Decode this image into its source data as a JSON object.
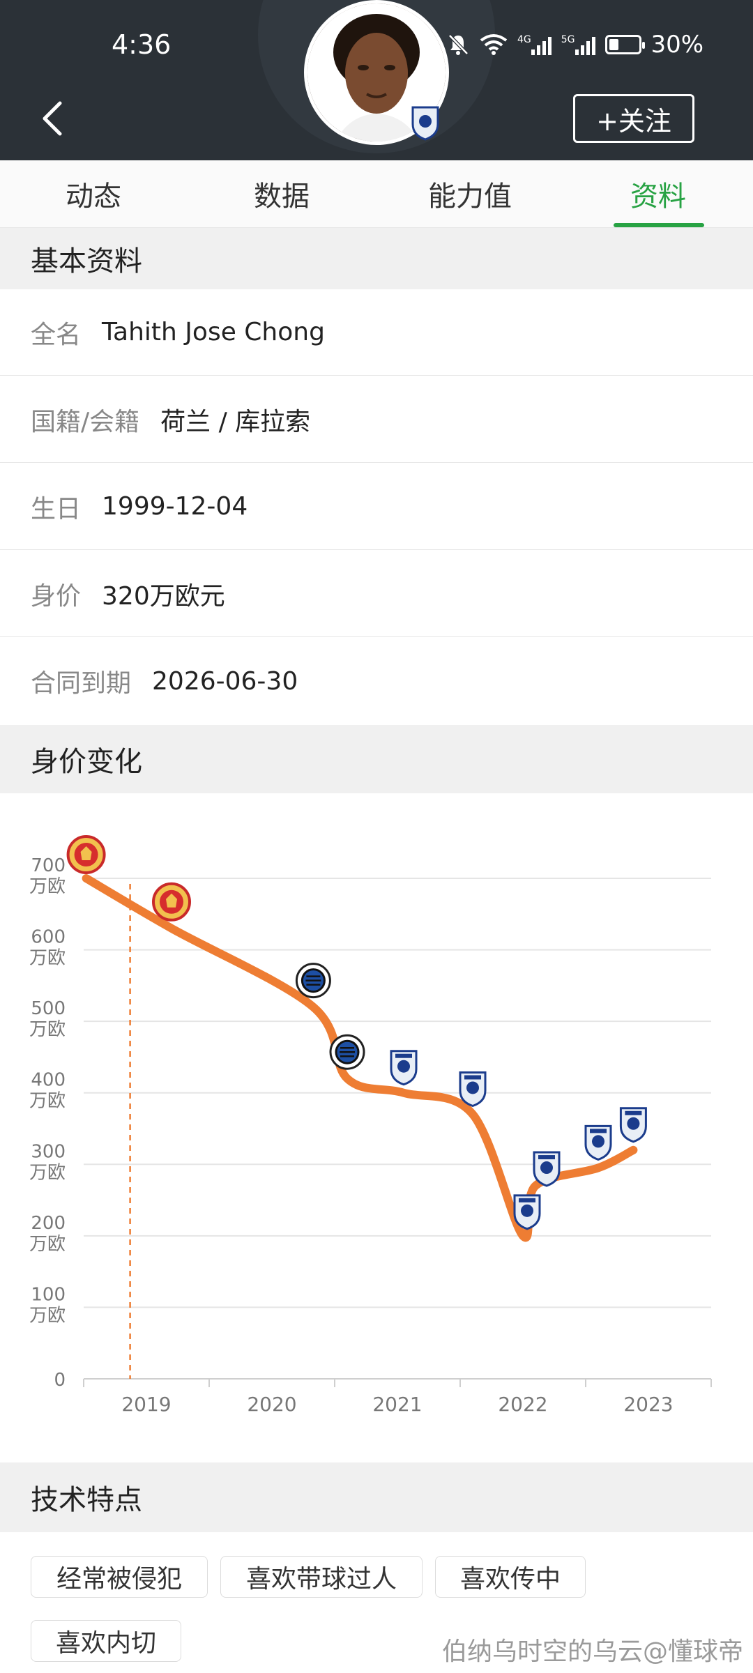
{
  "status_bar": {
    "time": "4:36",
    "signal1": "4G",
    "signal2": "5G",
    "battery_text": "30%",
    "battery_level": 0.3
  },
  "header": {
    "follow_label": "+关注"
  },
  "tabs": [
    {
      "label": "动态"
    },
    {
      "label": "数据"
    },
    {
      "label": "能力值"
    },
    {
      "label": "资料",
      "active": true
    }
  ],
  "basic_info": {
    "title": "基本资料",
    "rows": [
      {
        "label": "全名",
        "value": "Tahith Jose Chong"
      },
      {
        "label": "国籍/会籍",
        "value": "荷兰 / 库拉索"
      },
      {
        "label": "生日",
        "value": "1999-12-04"
      },
      {
        "label": "身价",
        "value": "320万欧元"
      },
      {
        "label": "合同到期",
        "value": "2026-06-30"
      }
    ]
  },
  "value_section": {
    "title": "身价变化"
  },
  "chart_data": {
    "type": "line",
    "x_tick_labels": [
      "2019",
      "2020",
      "2021",
      "2022",
      "2023"
    ],
    "y_ticks": [
      {
        "value": 0,
        "label": "0",
        "unit": ""
      },
      {
        "value": 100,
        "label": "100",
        "unit": "万欧"
      },
      {
        "value": 200,
        "label": "200",
        "unit": "万欧"
      },
      {
        "value": 300,
        "label": "300",
        "unit": "万欧"
      },
      {
        "value": 400,
        "label": "400",
        "unit": "万欧"
      },
      {
        "value": 500,
        "label": "500",
        "unit": "万欧"
      },
      {
        "value": 600,
        "label": "600",
        "unit": "万欧"
      },
      {
        "value": 700,
        "label": "700",
        "unit": "万欧"
      }
    ],
    "ylim": [
      0,
      700
    ],
    "xlim": [
      2018.5,
      2023.5
    ],
    "marker_line_x": 2018.87,
    "points": [
      {
        "x": 2018.52,
        "y": 700,
        "club": "man-utd"
      },
      {
        "x": 2019.2,
        "y": 630,
        "club": "man-utd"
      },
      {
        "x": 2020.33,
        "y": 520,
        "club": "club-brugge"
      },
      {
        "x": 2020.6,
        "y": 420,
        "club": "club-brugge"
      },
      {
        "x": 2021.05,
        "y": 400,
        "club": "birmingham"
      },
      {
        "x": 2021.6,
        "y": 370,
        "club": "birmingham"
      },
      {
        "x": 2022.0,
        "y": 200,
        "club": "birmingham"
      },
      {
        "x": 2022.1,
        "y": 270,
        "club": "birmingham"
      },
      {
        "x": 2022.6,
        "y": 295,
        "club": "birmingham"
      },
      {
        "x": 2022.88,
        "y": 320,
        "club": "birmingham"
      }
    ],
    "line_color": "#ee7d33",
    "grid": true
  },
  "tech_section": {
    "title": "技术特点",
    "tags": [
      "经常被侵犯",
      "喜欢带球过人",
      "喜欢传中",
      "喜欢内切"
    ]
  },
  "watermark": "伯纳乌时空的乌云@懂球帝"
}
